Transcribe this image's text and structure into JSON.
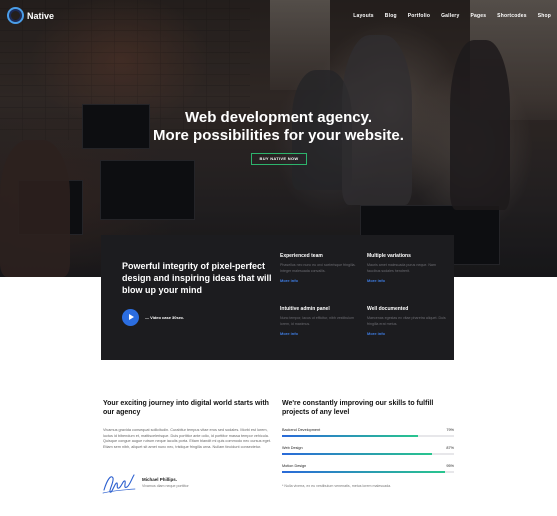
{
  "brand": {
    "name": "Native"
  },
  "nav": {
    "items": [
      "Layouts",
      "Blog",
      "Portfolio",
      "Gallery",
      "Pages",
      "Shortcodes",
      "Shop"
    ]
  },
  "hero": {
    "title_line1": "Web development agency.",
    "title_line2": "More possibilities for your website.",
    "button_label": "BUY NATIVE NOW"
  },
  "feature_box": {
    "headline": "Powerful integrity of pixel-perfect design and inspiring ideas that will blow up your mind",
    "video_label": "— Video case 30sec.",
    "features": [
      {
        "title": "Experienced team",
        "desc": "Phasellus nec nunc eu orci scelerisque fringilla. Integer malesuada convallis.",
        "link": "More info"
      },
      {
        "title": "Multiple variations",
        "desc": "Mauris amet malesuada purus neque. Nam faucibus sodales hendrerit.",
        "link": "More info"
      },
      {
        "title": "Intuitive admin panel",
        "desc": "Nunc tempor, lacus ut efficitur, nibh vestibulum lorem, id maximus.",
        "link": "More info"
      },
      {
        "title": "Well documented",
        "desc": "Maecenas egestas ex vitae pharetra aliquet. Duis fringilla erat metus.",
        "link": "More info"
      }
    ]
  },
  "journey": {
    "title": "Your exciting journey into digital world starts with our agency",
    "text": "Vivamus gravida consequat sollicitudin. Curabitur tempus vitae eros sed sodales. Morbi est lorem, luctus id bibendum et, mattiscelerisque. Duis porttitor ante odio, id porttitor massa tempor vehicula. Quisque congue augue rutrum neque iaculis porta. Etiam blandit mi quis commodo nec cursus eget. Etiam sem nibh, aliquet sit amet nunc nec, tristique fringilla urna. Nullam tincidunt consectetur.",
    "author_name": "Michael Phillips.",
    "author_role": "Vivamus diam neque porttitor"
  },
  "skills": {
    "title": "We're constantly improving our skills to fulfill projects of any level",
    "items": [
      {
        "label": "Backend Development",
        "value_text": "79%",
        "value": 79
      },
      {
        "label": "Web Design",
        "value_text": "87%",
        "value": 87
      },
      {
        "label": "Motion Design",
        "value_text": "95%",
        "value": 95
      }
    ],
    "note": "* Nulla viverra, ex eu vestibulum venenatis, metus lorem malesuada."
  }
}
